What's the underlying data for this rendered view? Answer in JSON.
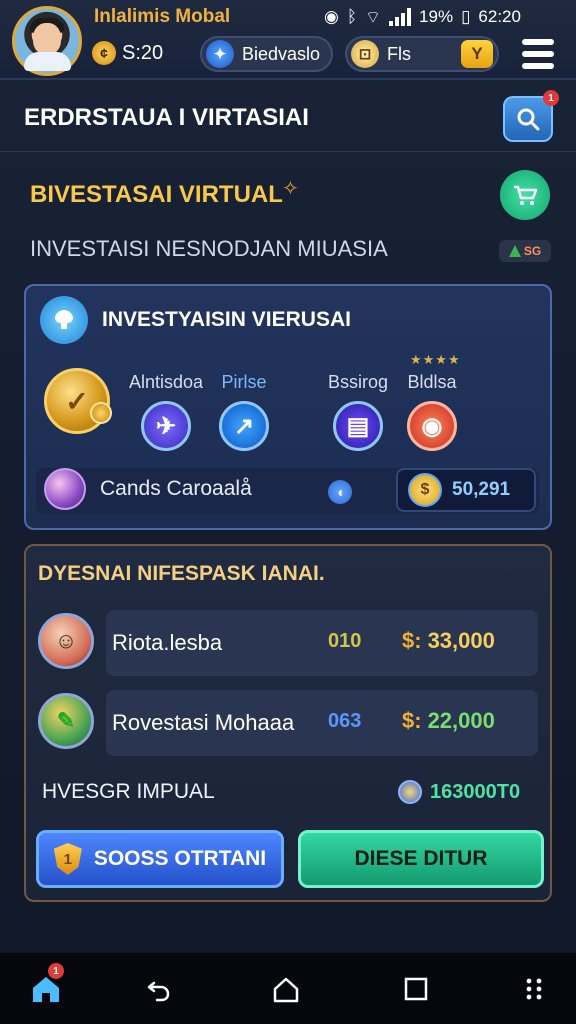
{
  "header": {
    "app_name": "Inlalimis Mobal",
    "coins": "S:20",
    "pill_a": "Biedvaslo",
    "pill_b": "Fls",
    "status_bar": {
      "battery": "19%",
      "time": "62:20"
    }
  },
  "page": {
    "title": "ERDRSTAUA I VIRTASIAI",
    "search_badge": "1"
  },
  "virtual": {
    "title": "BIVESTASAI VIRTUAL",
    "subtitle": "INVESTAISI NESNODJAN MIUASIA",
    "badge_text": "SG"
  },
  "investment_card": {
    "title": "INVESTYAISIN VIERUSAI",
    "options": [
      {
        "label": "Alntisdoa"
      },
      {
        "label": "Pirlse"
      },
      {
        "label": "Bssirog"
      },
      {
        "label": "Bldlsa"
      }
    ],
    "stars": "★★★★",
    "footer": {
      "label": "Cands Caroaalå",
      "value": "50,291"
    }
  },
  "portfolio_card": {
    "title": "DYESNAI NIFESPASK IANAI.",
    "rows": [
      {
        "name": "Riota.lesba",
        "code": "010",
        "amount": "33,000"
      },
      {
        "name": "Rovestasi Mohaaa",
        "code": "063",
        "amount": "22,000"
      }
    ],
    "summary_label": "HVESGR IMPUAL",
    "summary_value": "163000T0",
    "button_left": "SOOSS OTRTANI",
    "button_right": "DIESE DITUR"
  },
  "bottom_nav": {
    "badge": "1"
  },
  "icons": {
    "search": "search-icon",
    "cart": "cart-icon",
    "menu": "menu-icon",
    "home": "home-icon",
    "back": "back-icon",
    "circle_home": "circle-home-icon",
    "recent": "square-icon",
    "more": "dots-icon"
  },
  "colors": {
    "gold": "#F8C948",
    "teal": "#32D8A2",
    "blue": "#4D87FF",
    "card_border": "#4B6AA8"
  }
}
